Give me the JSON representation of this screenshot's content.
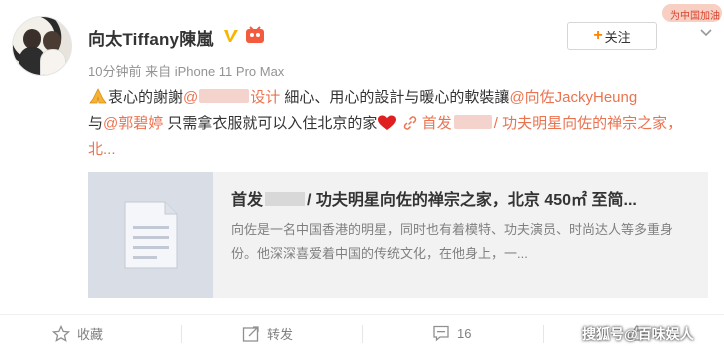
{
  "user": {
    "name": "向太Tiffany陳嵐",
    "time": "10分钟前",
    "source": "来自 iPhone 11 Pro Max"
  },
  "follow_label": "关注",
  "promo_label": "为中国加油",
  "post": {
    "t1": "衷心的謝謝",
    "mention1_suffix": "设计",
    "t2": " 細心、用心的設計与暖心的軟裝讓",
    "mention2": "@向佐JackyHeung",
    "t3": "与",
    "mention3": "@郭碧婷",
    "t4": " 只需拿衣服就可以入住北京的家",
    "link_prefix": "首发",
    "link_rest": "/ 功夫明星向佐的禅宗之家，北..."
  },
  "card": {
    "title_prefix": "首发",
    "title_rest": "/ 功夫明星向佐的禅宗之家，北京 450㎡ 至简...",
    "desc": "向佐是一名中国香港的明星，同时也有着模特、功夫演员、时尚达人等多重身份。他深深喜爱着中国的传统文化，在他身上，一..."
  },
  "actions": {
    "favorite": "收藏",
    "forward": "转发",
    "comment_count": "16"
  },
  "watermark": "搜狐号@百味娱人",
  "colors": {
    "link": "#eb7350",
    "accent": "#ff8200"
  }
}
